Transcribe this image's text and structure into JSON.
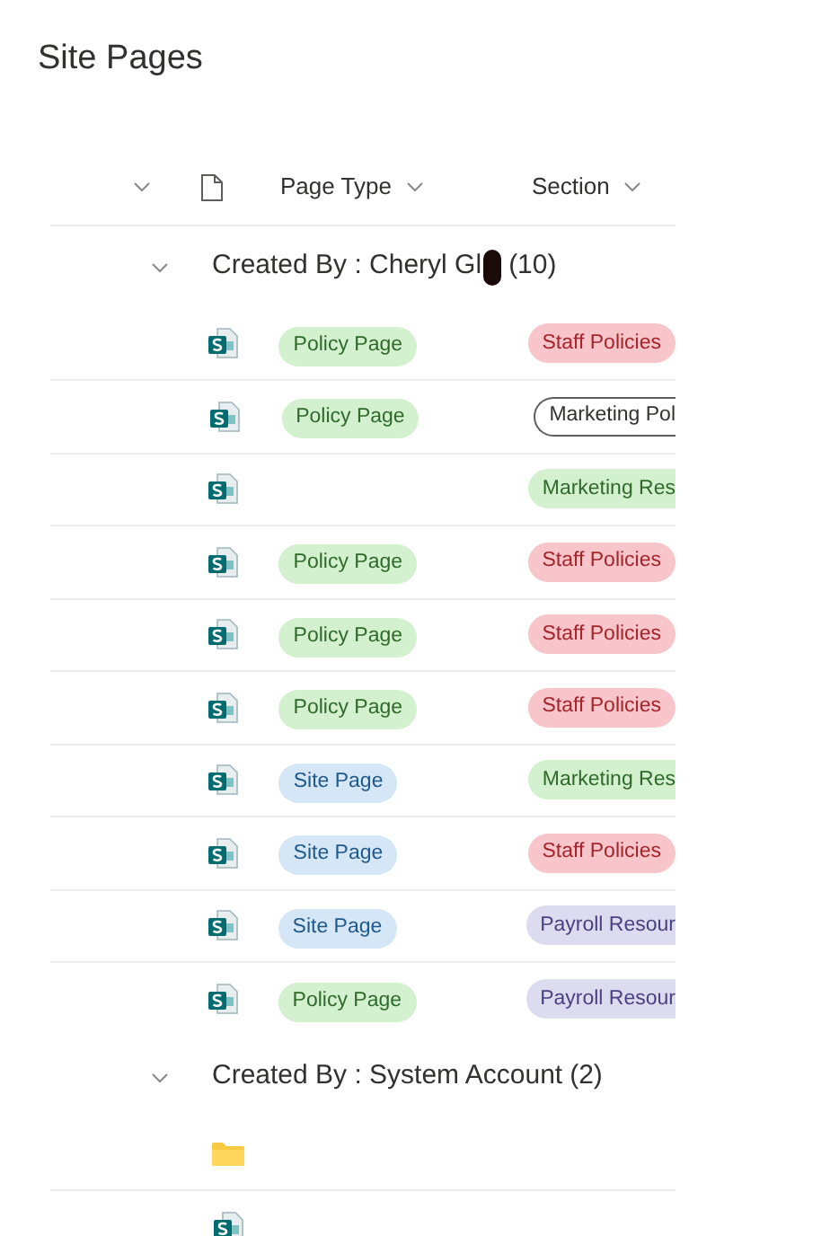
{
  "title": "Site Pages",
  "columns": [
    {
      "label": "Page Type"
    },
    {
      "label": "Section"
    }
  ],
  "groups": [
    {
      "label": "Created By : Cheryl Gl",
      "count": "(10)",
      "redacted": true,
      "expanded": true,
      "rows": [
        {
          "kind": "page",
          "page_type": {
            "text": "Policy Page",
            "color": "#d3f0cf"
          },
          "section": {
            "text": "Staff Policies",
            "color": "#f7c5ca",
            "kind": "filled"
          }
        },
        {
          "kind": "page",
          "page_type": {
            "text": "Policy Page",
            "color": "#d3f0cf"
          },
          "section": {
            "text": "Marketing Pol",
            "color": "#ffffff",
            "kind": "cut-outlined"
          }
        },
        {
          "kind": "page",
          "section": {
            "text": "Marketing Res",
            "color": "#d3f0cf",
            "kind": "cut"
          }
        },
        {
          "kind": "page",
          "page_type": {
            "text": "Policy Page",
            "color": "#d3f0cf"
          },
          "section": {
            "text": "Staff Policies",
            "color": "#f7c5ca",
            "kind": "filled"
          }
        },
        {
          "kind": "page",
          "page_type": {
            "text": "Policy Page",
            "color": "#d3f0cf"
          },
          "section": {
            "text": "Staff Policies",
            "color": "#f7c5ca",
            "kind": "filled"
          }
        },
        {
          "kind": "page",
          "page_type": {
            "text": "Policy Page",
            "color": "#d3f0cf"
          },
          "section": {
            "text": "Staff Policies",
            "color": "#f7c5ca",
            "kind": "filled"
          }
        },
        {
          "kind": "page",
          "page_type": {
            "text": "Site Page",
            "color": "#d5e7f7"
          },
          "section": {
            "text": "Marketing Res",
            "color": "#d3f0cf",
            "kind": "cut"
          }
        },
        {
          "kind": "page",
          "page_type": {
            "text": "Site Page",
            "color": "#d5e7f7"
          },
          "section": {
            "text": "Staff Policies",
            "color": "#f7c5ca",
            "kind": "filled"
          }
        },
        {
          "kind": "page",
          "page_type": {
            "text": "Site Page",
            "color": "#d5e7f7"
          },
          "section": {
            "text": "Payroll Resour",
            "color": "#dddbf0",
            "kind": "cut"
          }
        },
        {
          "kind": "page",
          "page_type": {
            "text": "Policy Page",
            "color": "#d3f0cf"
          },
          "section": {
            "text": "Payroll Resour",
            "color": "#dddbf0",
            "kind": "cut"
          }
        }
      ]
    },
    {
      "label": "Created By : System Account",
      "count": "(2)",
      "redacted": false,
      "expanded": true,
      "rows": [
        {
          "kind": "folder"
        },
        {
          "kind": "page"
        }
      ]
    }
  ]
}
